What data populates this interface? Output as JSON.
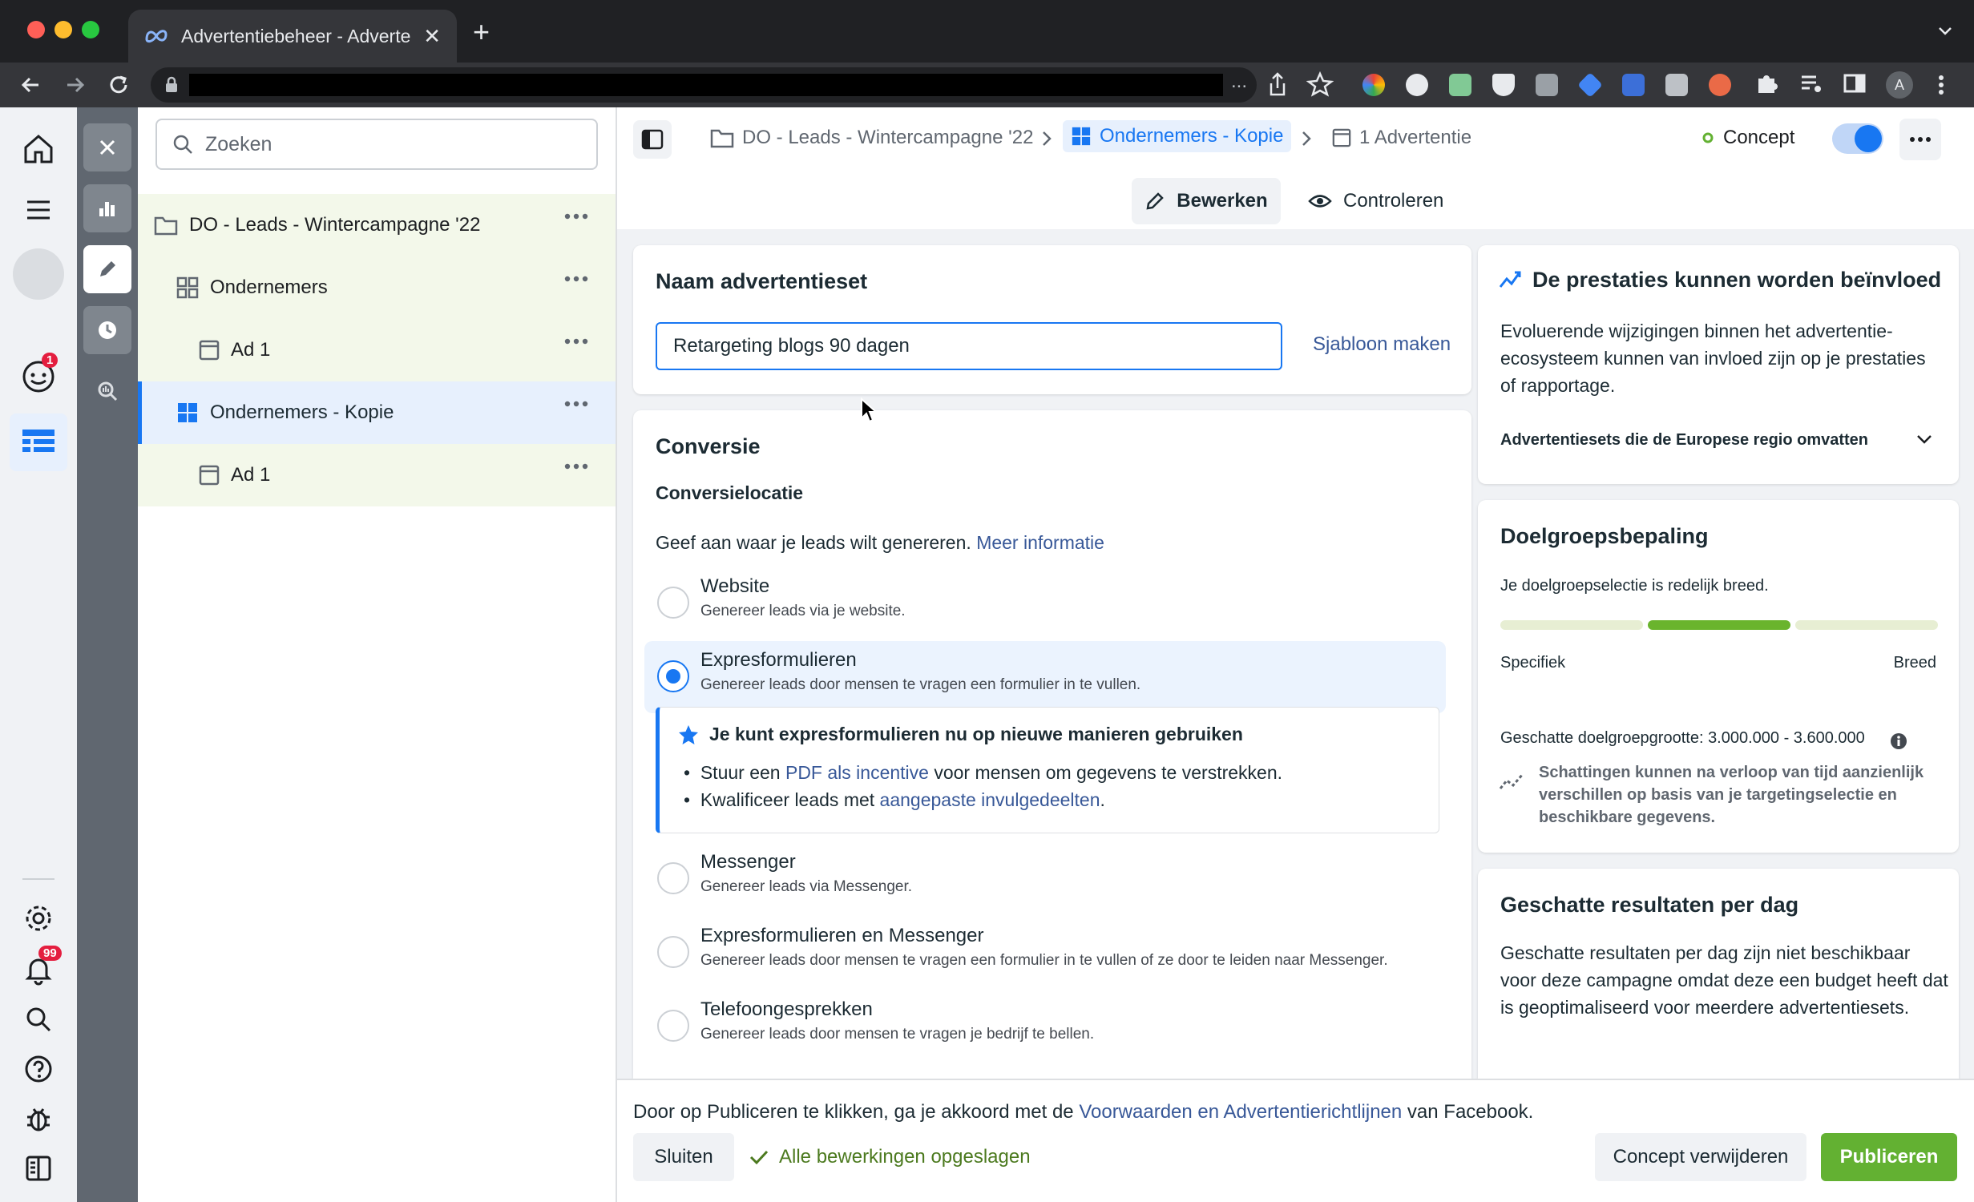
{
  "browser": {
    "tab_title": "Advertentiebeheer - Advertent",
    "tab_close": "✕",
    "new_tab": "+",
    "address_dots": "..."
  },
  "rail": {
    "notification_badge_1": "1",
    "notification_badge_99": "99"
  },
  "tree": {
    "search_placeholder": "Zoeken",
    "items": [
      {
        "label": "DO - Leads - Wintercampagne '22"
      },
      {
        "label": "Ondernemers"
      },
      {
        "label": "Ad 1"
      },
      {
        "label": "Ondernemers - Kopie"
      },
      {
        "label": "Ad 1"
      }
    ]
  },
  "breadcrumb": {
    "campaign": "DO - Leads - Wintercampagne '22",
    "adset": "Ondernemers - Kopie",
    "ads": "1 Advertentie",
    "status": "Concept"
  },
  "modes": {
    "edit": "Bewerken",
    "review": "Controleren"
  },
  "name_card": {
    "title": "Naam advertentieset",
    "value": "Retargeting blogs 90 dagen",
    "template_link": "Sjabloon maken"
  },
  "conversion": {
    "title": "Conversie",
    "subtitle": "Conversielocatie",
    "intro": "Geef aan waar je leads wilt genereren.",
    "intro_link": "Meer informatie",
    "options": [
      {
        "title": "Website",
        "sub": "Genereer leads via je website.",
        "selected": false
      },
      {
        "title": "Expresformulieren",
        "sub": "Genereer leads door mensen te vragen een formulier in te vullen.",
        "selected": true
      },
      {
        "title": "Messenger",
        "sub": "Genereer leads via Messenger.",
        "selected": false
      },
      {
        "title": "Expresformulieren en Messenger",
        "sub": "Genereer leads door mensen te vragen een formulier in te vullen of ze door te leiden naar Messenger.",
        "selected": false
      },
      {
        "title": "Telefoongesprekken",
        "sub": "Genereer leads door mensen te vragen je bedrijf te bellen.",
        "selected": false
      }
    ],
    "tip": {
      "title": "Je kunt expresformulieren nu op nieuwe manieren gebruiken",
      "b1_pre": "Stuur een ",
      "b1_link": "PDF als incentive",
      "b1_post": " voor mensen om gegevens te verstrekken.",
      "b2_pre": "Kwalificeer leads met ",
      "b2_link": "aangepaste invulgedeelten",
      "b2_post": "."
    }
  },
  "performance": {
    "title": "De prestaties kunnen worden beïnvloed",
    "body": "Evoluerende wijzigingen binnen het advertentie-ecosysteem kunnen van invloed zijn op je prestaties of rapportage.",
    "expander": "Advertentiesets die de Europese regio omvatten"
  },
  "audience": {
    "title": "Doelgroepsbepaling",
    "summary": "Je doelgroepselectie is redelijk breed.",
    "left_label": "Specifiek",
    "right_label": "Breed",
    "breadth_segment": 2,
    "breadth_segments": 3,
    "size": "Geschatte doelgroepgrootte: 3.000.000 - 3.600.000",
    "note": "Schattingen kunnen na verloop van tijd aanzienlijk verschillen op basis van je targetingselectie en beschikbare gegevens."
  },
  "results": {
    "title": "Geschatte resultaten per dag",
    "body": "Geschatte resultaten per dag zijn niet beschikbaar voor deze campagne omdat deze een budget heeft dat is geoptimaliseerd voor meerdere advertentiesets."
  },
  "footer": {
    "legal_pre": "Door op Publiceren te klikken, ga je akkoord met de ",
    "legal_link": "Voorwaarden en Advertentierichtlijnen",
    "legal_post": " van Facebook.",
    "close": "Sluiten",
    "saved": "Alle bewerkingen opgeslagen",
    "discard": "Concept verwijderen",
    "publish": "Publiceren"
  },
  "colors": {
    "accent": "#1877f2",
    "publish_green": "#63b132",
    "audience_active": "#6ab42d",
    "audience_inactive": "#e7eed3"
  }
}
